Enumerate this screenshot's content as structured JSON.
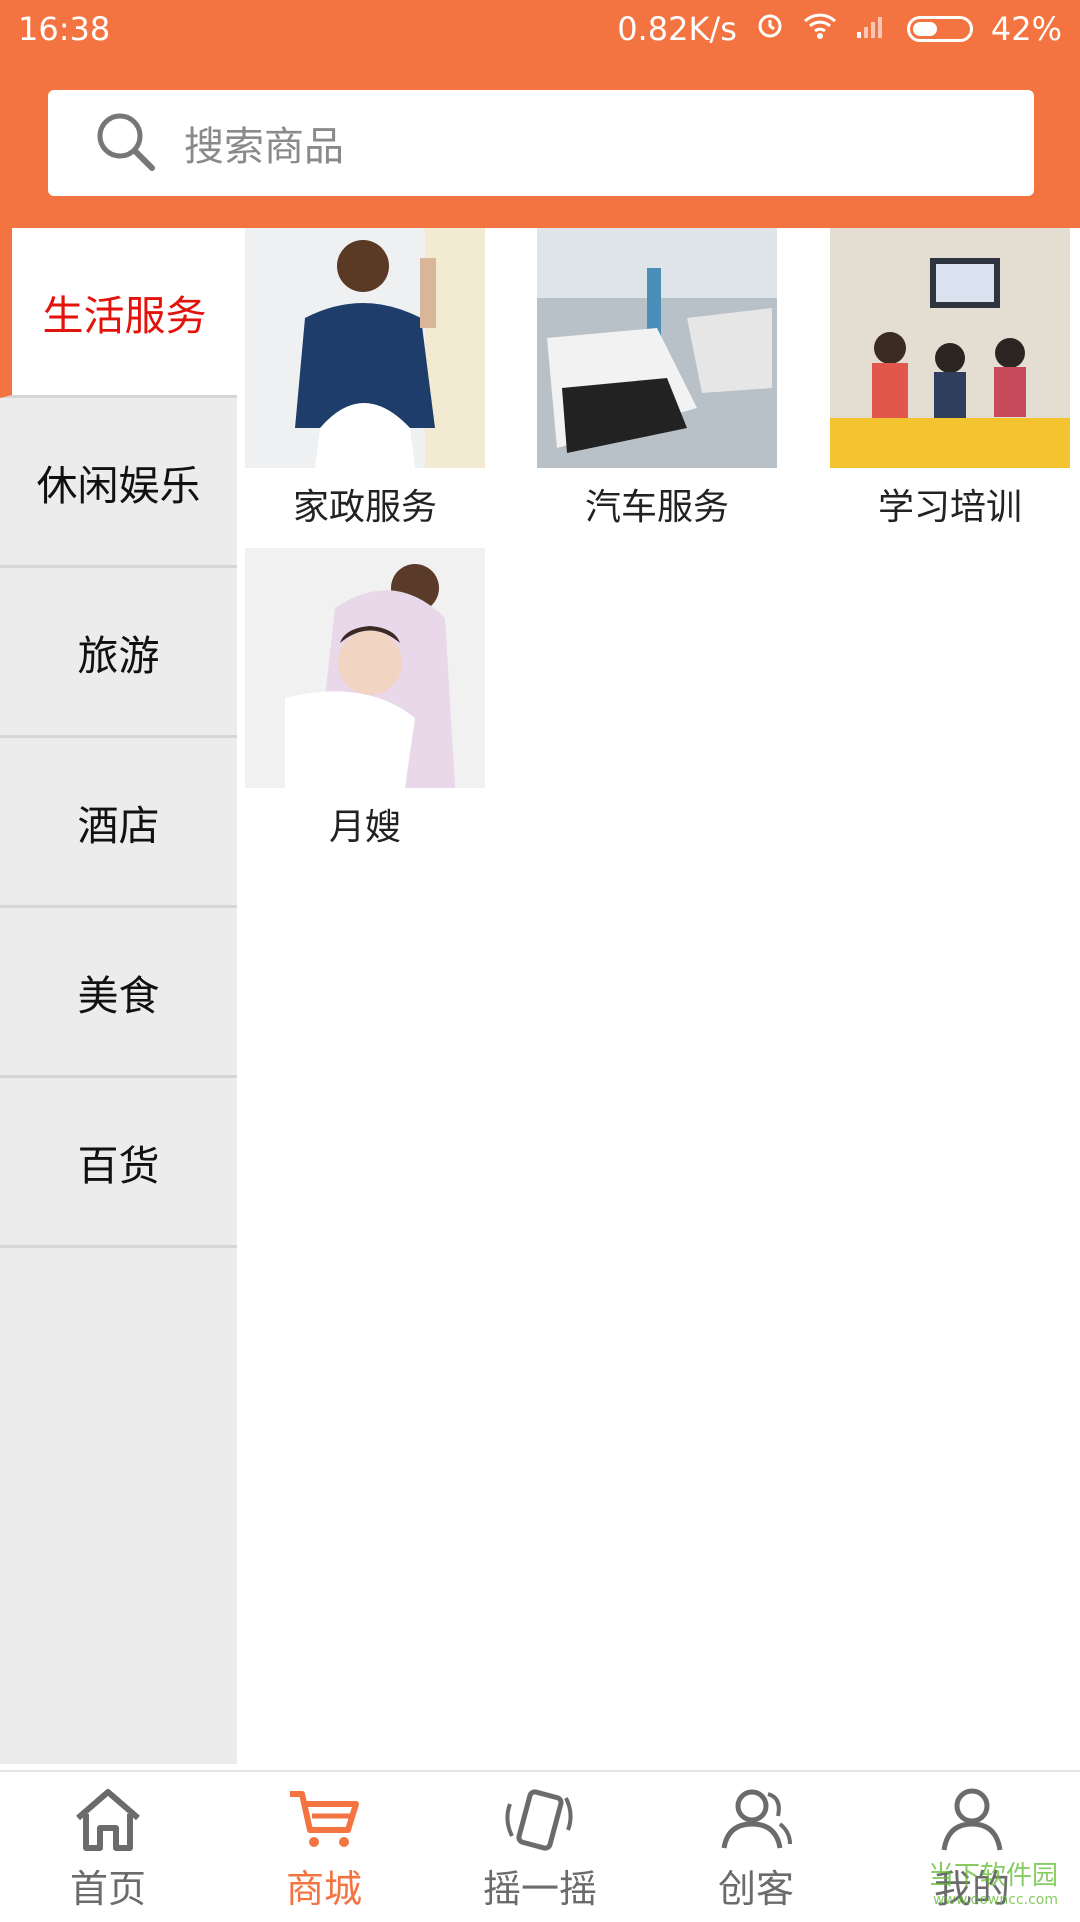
{
  "status": {
    "time": "16:38",
    "network_speed": "0.82K/s",
    "battery": "42%"
  },
  "search": {
    "placeholder": "搜索商品"
  },
  "sidebar": {
    "items": [
      {
        "label": "生活服务",
        "active": true
      },
      {
        "label": "休闲娱乐"
      },
      {
        "label": "旅游"
      },
      {
        "label": "酒店"
      },
      {
        "label": "美食"
      },
      {
        "label": "百货"
      }
    ]
  },
  "services": [
    {
      "label": "家政服务"
    },
    {
      "label": "汽车服务"
    },
    {
      "label": "学习培训"
    },
    {
      "label": "月嫂"
    }
  ],
  "tabbar": {
    "tabs": [
      {
        "label": "首页",
        "icon": "home-icon"
      },
      {
        "label": "商城",
        "icon": "cart-icon",
        "active": true
      },
      {
        "label": "摇一摇",
        "icon": "shake-phone-icon"
      },
      {
        "label": "创客",
        "icon": "people-icon"
      },
      {
        "label": "我的",
        "icon": "person-icon"
      }
    ]
  },
  "watermark": {
    "text": "当下软件园",
    "url": "www.downcc.com"
  },
  "colors": {
    "accent": "#f37441",
    "active_category": "#e3120b",
    "sidebar_bg": "#ececec"
  }
}
